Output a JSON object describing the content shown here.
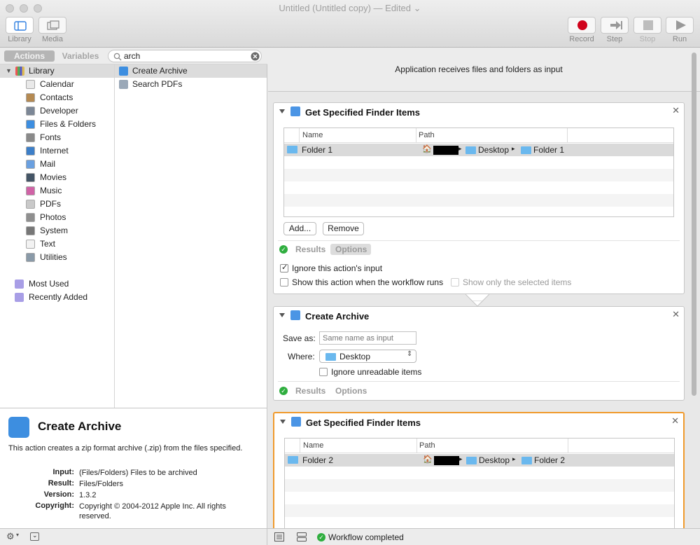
{
  "window": {
    "title": "Untitled (Untitled copy)",
    "edited": "— Edited"
  },
  "toolbar": {
    "library_label": "Library",
    "media_label": "Media",
    "record_label": "Record",
    "step_label": "Step",
    "stop_label": "Stop",
    "run_label": "Run"
  },
  "library": {
    "tab_actions": "Actions",
    "tab_variables": "Variables",
    "search_value": "arch",
    "root": "Library",
    "categories": [
      {
        "label": "Calendar",
        "icon": "calendar-icon"
      },
      {
        "label": "Contacts",
        "icon": "contacts-icon"
      },
      {
        "label": "Developer",
        "icon": "developer-icon"
      },
      {
        "label": "Files & Folders",
        "icon": "finder-icon"
      },
      {
        "label": "Fonts",
        "icon": "fonts-icon"
      },
      {
        "label": "Internet",
        "icon": "internet-icon"
      },
      {
        "label": "Mail",
        "icon": "mail-icon"
      },
      {
        "label": "Movies",
        "icon": "movies-icon"
      },
      {
        "label": "Music",
        "icon": "music-icon"
      },
      {
        "label": "PDFs",
        "icon": "pdf-icon"
      },
      {
        "label": "Photos",
        "icon": "photos-icon"
      },
      {
        "label": "System",
        "icon": "system-icon"
      },
      {
        "label": "Text",
        "icon": "text-icon"
      },
      {
        "label": "Utilities",
        "icon": "utilities-icon"
      }
    ],
    "most_used": "Most Used",
    "recently_added": "Recently Added",
    "actions": [
      "Create Archive",
      "Search PDFs"
    ]
  },
  "description": {
    "title": "Create Archive",
    "text": "This action creates a zip format archive (.zip) from the files specified.",
    "input_key": "Input:",
    "input_val": "(Files/Folders) Files to be archived",
    "result_key": "Result:",
    "result_val": "Files/Folders",
    "version_key": "Version:",
    "version_val": "1.3.2",
    "copyright_key": "Copyright:",
    "copyright_val": "Copyright © 2004-2012 Apple Inc.  All rights reserved."
  },
  "workflow": {
    "header": "Application receives files and folders as input",
    "card1": {
      "title": "Get Specified Finder Items",
      "col_name": "Name",
      "col_path": "Path",
      "row_name": "Folder 1",
      "path_desktop": "Desktop",
      "path_folder": "Folder 1",
      "add_label": "Add...",
      "remove_label": "Remove",
      "results_label": "Results",
      "options_label": "Options",
      "ignore_input_label": "Ignore this action's input",
      "ignore_input_checked": true,
      "show_action_label": "Show this action when the workflow runs",
      "show_selected_label": "Show only the selected items"
    },
    "card2": {
      "title": "Create Archive",
      "save_as_label": "Save as:",
      "save_as_placeholder": "Same name as input",
      "where_label": "Where:",
      "where_value": "Desktop",
      "ignore_unreadable_label": "Ignore unreadable items",
      "results_label": "Results",
      "options_label": "Options"
    },
    "card3": {
      "title": "Get Specified Finder Items",
      "col_name": "Name",
      "col_path": "Path",
      "row_name": "Folder 2",
      "path_desktop": "Desktop",
      "path_folder": "Folder 2"
    }
  },
  "status": {
    "text": "Workflow completed"
  },
  "colors": {
    "accent_selected_card": "#f09a2c",
    "record_red": "#d0021b",
    "success_green": "#2fae3f",
    "folder_blue": "#6ab8ee"
  }
}
